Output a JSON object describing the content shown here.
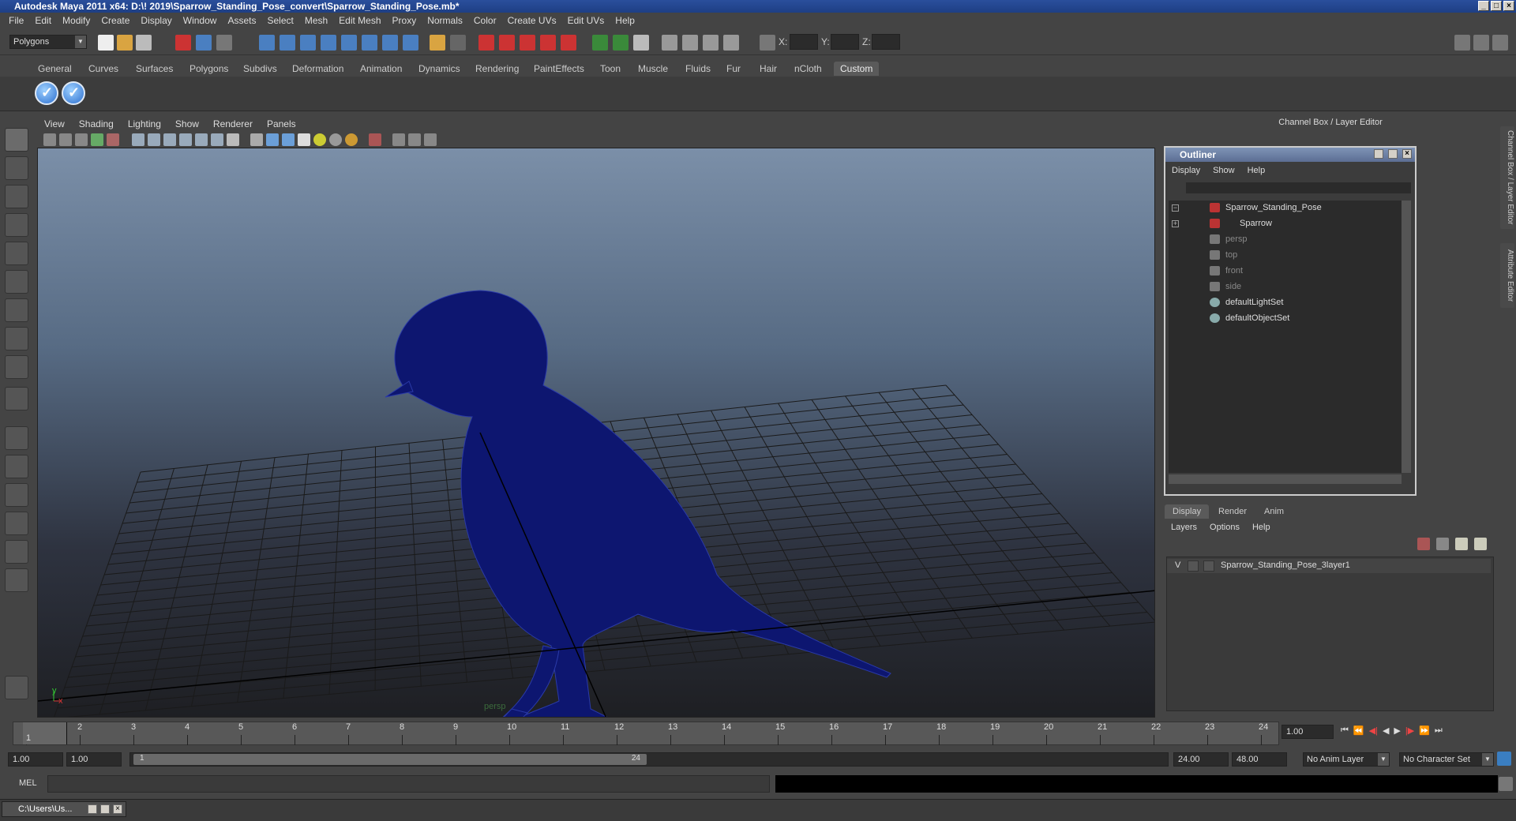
{
  "window": {
    "title": "Autodesk Maya 2011 x64: D:\\! 2019\\Sparrow_Standing_Pose_convert\\Sparrow_Standing_Pose.mb*"
  },
  "menubar": [
    "File",
    "Edit",
    "Modify",
    "Create",
    "Display",
    "Window",
    "Assets",
    "Select",
    "Mesh",
    "Edit Mesh",
    "Proxy",
    "Normals",
    "Color",
    "Create UVs",
    "Edit UVs",
    "Help"
  ],
  "status": {
    "mode": "Polygons",
    "x_label": "X:",
    "y_label": "Y:",
    "z_label": "Z:"
  },
  "shelf_tabs": [
    "General",
    "Curves",
    "Surfaces",
    "Polygons",
    "Subdivs",
    "Deformation",
    "Animation",
    "Dynamics",
    "Rendering",
    "PaintEffects",
    "Toon",
    "Muscle",
    "Fluids",
    "Fur",
    "Hair",
    "nCloth",
    "Custom"
  ],
  "shelf_active": "Custom",
  "viewport": {
    "menu": [
      "View",
      "Shading",
      "Lighting",
      "Show",
      "Renderer",
      "Panels"
    ],
    "camera_label": "persp",
    "axis_y": "y",
    "axis_x": "x"
  },
  "channel_box": {
    "title": "Channel Box / Layer Editor",
    "side_tab_1": "Channel Box / Layer Editor",
    "side_tab_2": "Attribute Editor"
  },
  "outliner": {
    "title": "Outliner",
    "menu": [
      "Display",
      "Show",
      "Help"
    ],
    "items": [
      {
        "label": "Sparrow_Standing_Pose",
        "expander": "−"
      },
      {
        "label": "Sparrow",
        "expander": "+"
      },
      {
        "label": "persp",
        "expander": ""
      },
      {
        "label": "top",
        "expander": ""
      },
      {
        "label": "front",
        "expander": ""
      },
      {
        "label": "side",
        "expander": ""
      },
      {
        "label": "defaultLightSet",
        "expander": ""
      },
      {
        "label": "defaultObjectSet",
        "expander": ""
      }
    ]
  },
  "layer_editor": {
    "tabs": [
      "Display",
      "Render",
      "Anim"
    ],
    "menu": [
      "Layers",
      "Options",
      "Help"
    ],
    "layer_vis": "V",
    "layer_name": "Sparrow_Standing_Pose_3layer1"
  },
  "timeline": {
    "ticks": [
      "1",
      "2",
      "3",
      "4",
      "5",
      "6",
      "7",
      "8",
      "9",
      "10",
      "11",
      "12",
      "13",
      "14",
      "15",
      "16",
      "17",
      "18",
      "19",
      "20",
      "21",
      "22",
      "23",
      "24"
    ],
    "current_frame": "1.00",
    "first_frame_marker": "1"
  },
  "range": {
    "start": "1.00",
    "playback_start": "1.00",
    "slider_start": "1",
    "slider_end": "24",
    "playback_end": "24.00",
    "end": "48.00",
    "anim_layer": "No Anim Layer",
    "character_set": "No Character Set"
  },
  "cmdline": {
    "label": "MEL"
  },
  "taskbar": {
    "window_chip": "C:\\Users\\Us..."
  }
}
